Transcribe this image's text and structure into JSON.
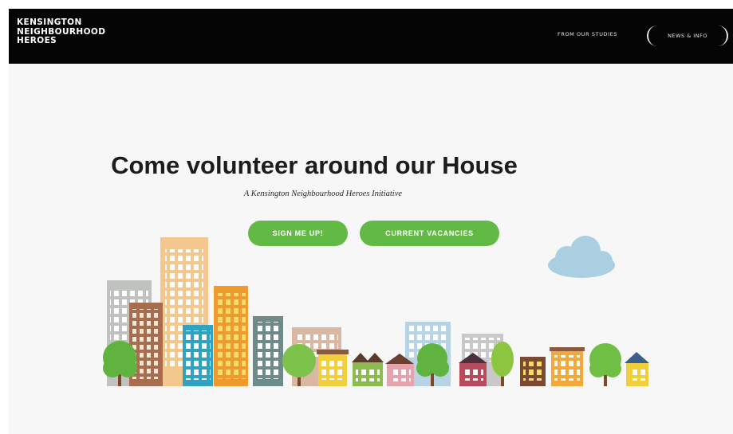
{
  "header": {
    "logo_lines": [
      "KENSINGTON",
      "NEIGHBOURHOOD",
      "HEROES"
    ],
    "nav_link_label": "FROM OUR STUDIES",
    "nav_cta_label": "NEWS & INFO"
  },
  "hero": {
    "title": "Come volunteer around our House",
    "subtitle": "A Kensington Neighbourhood Heroes Initiative",
    "signup_label": "SIGN ME UP!",
    "vacancies_label": "CURRENT VACANCIES"
  },
  "colors": {
    "navbar_bg": "#050505",
    "page_bg": "#f7f7f7",
    "button_green": "#62b944",
    "cloud_blue": "#a9cfe0"
  },
  "illustration": {
    "cloud": "cloud-icon",
    "trees": "tree-icon",
    "buildings": "building-icon"
  }
}
